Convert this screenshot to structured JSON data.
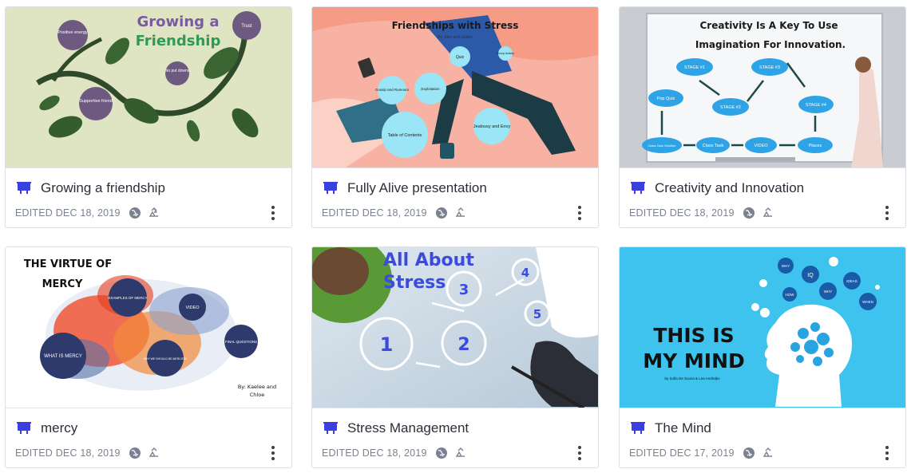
{
  "cards": [
    {
      "title": "Growing a friendship",
      "edited": "EDITED DEC 18, 2019",
      "thumb": {
        "title_line1": "Growing a",
        "title_line2": "Friendship",
        "bubbles": [
          "Positive energy",
          "Supportive friend",
          "No put downs",
          "Trust"
        ]
      }
    },
    {
      "title": "Fully Alive presentation",
      "edited": "EDITED DEC 18, 2019",
      "thumb": {
        "heading": "Friendships with Stress",
        "byline": "By: Alex and Jaiden",
        "bubbles": [
          "Quiz",
          "Group Activity",
          "Gossip and Rumours",
          "Exploitation",
          "Table of Contents",
          "Jealousy and Envy"
        ]
      }
    },
    {
      "title": "Creativity and Innovation",
      "edited": "EDITED DEC 18, 2019",
      "thumb": {
        "heading_line1": "Creativity Is A Key To Use",
        "heading_line2": "Imagination For Innovation.",
        "clouds": [
          "STAGE #1",
          "STAGE #2",
          "STAGE #3",
          "STAGE #4",
          "Pop Quiz",
          "Places",
          "VIDEO",
          "Class Task",
          "Class Task Solution"
        ]
      }
    },
    {
      "title": "mercy",
      "edited": "EDITED DEC 18, 2019",
      "thumb": {
        "heading_line1": "THE VIRTUE OF",
        "heading_line2": "MERCY",
        "bubbles": [
          "EXAMPLES OF MERCY",
          "VIDEO",
          "WHAT IS MERCY",
          "WHY WE SHOULD BE MERCIFUL",
          "FINAL QUESTIONS"
        ],
        "byline_line1": "By: Kaelee and",
        "byline_line2": "Chloe"
      }
    },
    {
      "title": "Stress Management",
      "edited": "EDITED DEC 18, 2019",
      "thumb": {
        "heading_line1": "All About",
        "heading_line2": "Stress",
        "numbers": [
          "1",
          "2",
          "3",
          "4",
          "5"
        ]
      }
    },
    {
      "title": "The Mind",
      "edited": "EDITED DEC 17, 2019",
      "thumb": {
        "heading_line1": "THIS IS",
        "heading_line2": "MY MIND",
        "byline": "by Sofia De Souza & Lea Andrejko",
        "bubbles": [
          "WHY",
          "IQ",
          "IDEAS",
          "HOW",
          "WHY",
          "WHEN"
        ]
      }
    }
  ],
  "icons": {
    "presentation": "presentation-icon",
    "visibility": "globe-icon",
    "reusable": "reuse-icon",
    "menu": "more-options-icon"
  },
  "colors": {
    "accent": "#3b3fe0",
    "title_text": "#2b2f38",
    "meta_text": "#7b8190"
  }
}
